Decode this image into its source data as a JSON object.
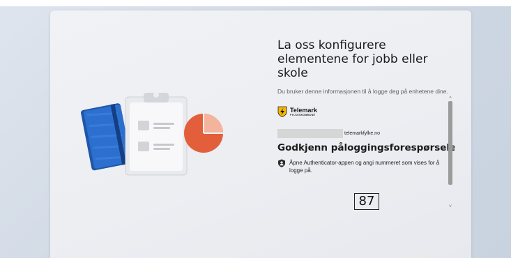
{
  "page": {
    "title": "La oss konfigurere elementene for jobb eller skole",
    "description": "Du bruker denne informasjonen til å logge deg på enhetene dine."
  },
  "signin": {
    "org_name": "Telemark",
    "org_subtitle": "FYLKESKOMMUNE",
    "email_domain": "telemarkfylke.no",
    "heading": "Godkjenn påloggingsforespørselen",
    "instruction": "Åpne Authenticator-appen og angi nummeret som vises for å logge på.",
    "number_code": "87"
  },
  "scrollbar": {
    "up_arrow": "˄",
    "down_arrow": "˅"
  },
  "colors": {
    "logo_shield": "#f5b800",
    "book_blue": "#2d6fcf",
    "pie_orange": "#e35f3b"
  },
  "icons": [
    "folder-illustration-icon",
    "clipboard-illustration-icon",
    "pie-chart-illustration-icon",
    "authenticator-icon"
  ]
}
